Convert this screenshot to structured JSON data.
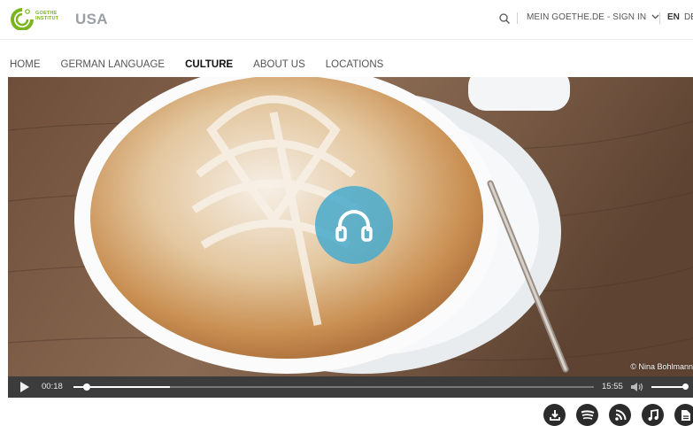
{
  "header": {
    "logo_text_line1": "GOETHE",
    "logo_text_line2": "INSTITUT",
    "region": "USA",
    "account_label": "MEIN GOETHE.DE - SIGN IN",
    "lang_active": "EN",
    "lang_other": "DE"
  },
  "nav": {
    "items": [
      {
        "label": "HOME",
        "active": false
      },
      {
        "label": "GERMAN LANGUAGE",
        "active": false
      },
      {
        "label": "CULTURE",
        "active": true
      },
      {
        "label": "ABOUT US",
        "active": false
      },
      {
        "label": "LOCATIONS",
        "active": false
      }
    ]
  },
  "hero": {
    "credit": "© Nina Bohlmann",
    "overlay_icon": "headphones-icon"
  },
  "player": {
    "current_time": "00:18",
    "total_time": "15:55",
    "progress_fraction": 0.019,
    "buffered_fraction": 0.185,
    "volume_fraction": 0.9
  },
  "actions": [
    {
      "icon": "download-icon"
    },
    {
      "icon": "spotify-icon"
    },
    {
      "icon": "rss-icon"
    },
    {
      "icon": "music-note-icon"
    },
    {
      "icon": "document-icon"
    }
  ],
  "colors": {
    "brand_green": "#7ab51d",
    "overlay_blue": "#48aacd",
    "player_bg": "#3c3c3c"
  }
}
